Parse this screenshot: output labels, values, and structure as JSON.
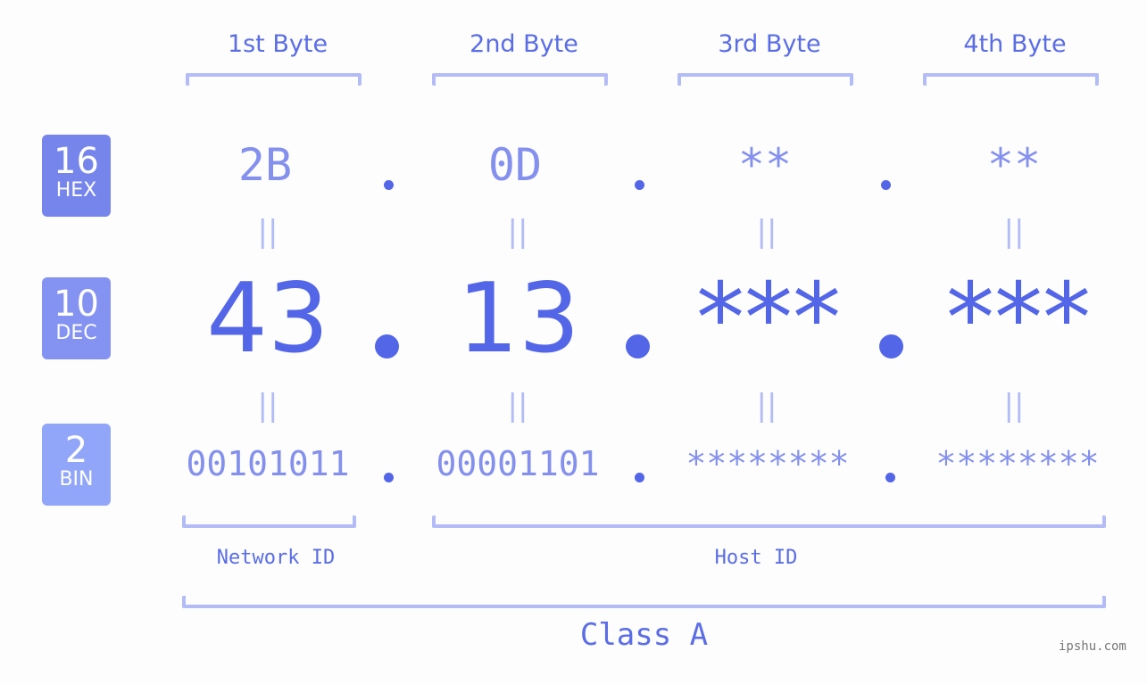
{
  "bytes": [
    {
      "label": "1st Byte",
      "hex": "2B",
      "dec": "43",
      "bin": "00101011"
    },
    {
      "label": "2nd Byte",
      "hex": "0D",
      "dec": "13",
      "bin": "00001101"
    },
    {
      "label": "3rd Byte",
      "hex": "**",
      "dec": "***",
      "bin": "********"
    },
    {
      "label": "4th Byte",
      "hex": "**",
      "dec": "***",
      "bin": "********"
    }
  ],
  "badges": {
    "hex": {
      "number": "16",
      "label": "HEX",
      "color": "#7685ec"
    },
    "dec": {
      "number": "10",
      "label": "DEC",
      "color": "#8492f1"
    },
    "bin": {
      "number": "2",
      "label": "BIN",
      "color": "#91a6f8"
    }
  },
  "equals_symbol": "||",
  "segments": {
    "network": "Network ID",
    "host": "Host ID"
  },
  "class_label": "Class A",
  "watermark": "ipshu.com",
  "colors": {
    "primary": "#5366e8",
    "light": "#8490ee",
    "bracket": "#b3bcf6"
  }
}
